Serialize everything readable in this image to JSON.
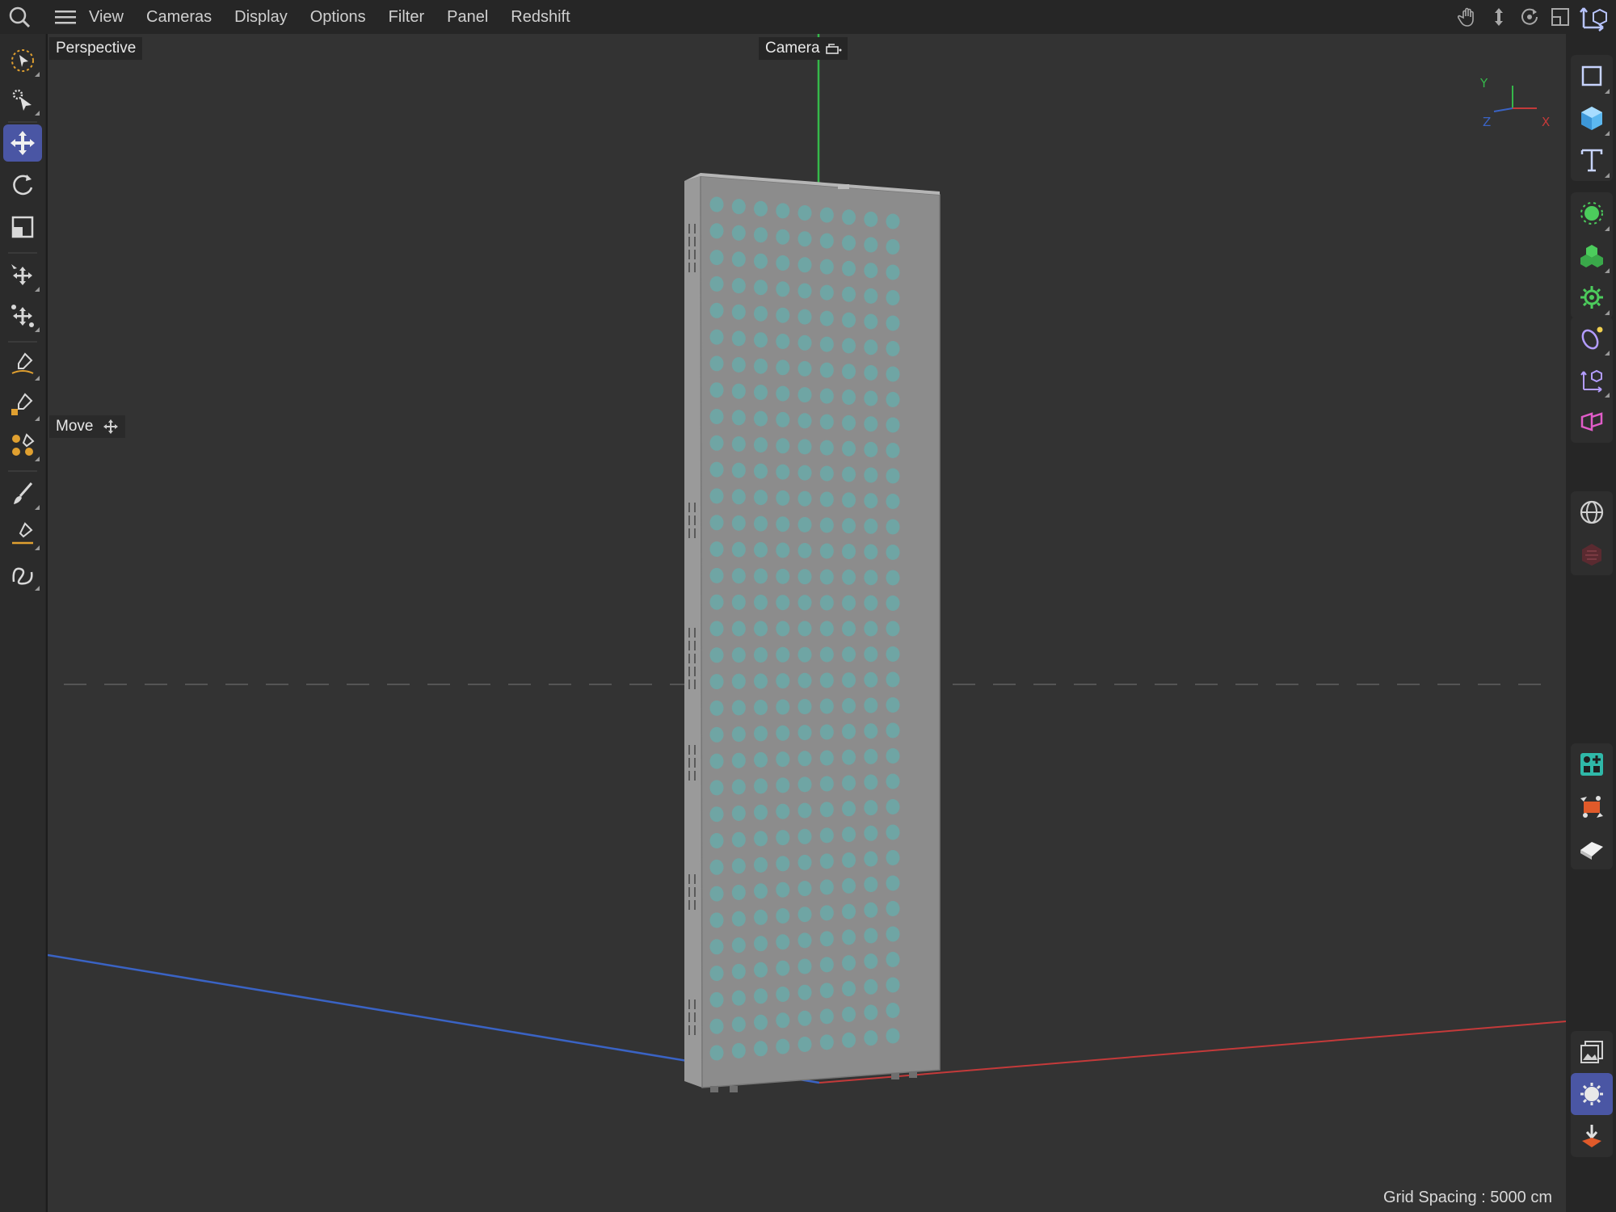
{
  "menubar": {
    "items": [
      "View",
      "Cameras",
      "Display",
      "Options",
      "Filter",
      "Panel",
      "Redshift"
    ],
    "icons": [
      "search-icon",
      "hamburger-icon",
      "pan-hand-icon",
      "dolly-icon",
      "orbit-icon",
      "maximize-view-icon",
      "workplane-icon"
    ]
  },
  "viewport": {
    "view_name": "Perspective",
    "camera_label": "Camera",
    "tool_label": "Move",
    "grid_spacing": "Grid Spacing : 5000 cm",
    "axes": {
      "y": "Y",
      "z": "Z",
      "x": "X"
    }
  },
  "colors": {
    "x_axis": "#c43a3a",
    "y_axis": "#35b84a",
    "z_axis": "#3a63c4",
    "accent_active": "#4a56a4",
    "panel_body": "#8c8c8c",
    "led": "#6fa5a4"
  },
  "left_toolbar": [
    "live-selection-icon",
    "select-tool-icon",
    "move-icon",
    "rotate-icon",
    "scale-icon",
    "transfer-icon",
    "multi-move-icon",
    "spline-pen-icon",
    "spline-sketch-icon",
    "spline-smooth-icon",
    "brush-icon",
    "knife-icon",
    "spline-icon"
  ],
  "right_toolbar": [
    "viewport-solo-icon",
    "cube-icon",
    "text-icon",
    "generator-icon",
    "cloner-icon",
    "deformer-icon",
    "field-icon",
    "null-icon",
    "camera-icon",
    "scene-icon",
    "redshift-icon",
    "node-editor-icon",
    "render-view-icon",
    "material-icon",
    "render-settings-icon",
    "render-icon",
    "import-icon"
  ]
}
